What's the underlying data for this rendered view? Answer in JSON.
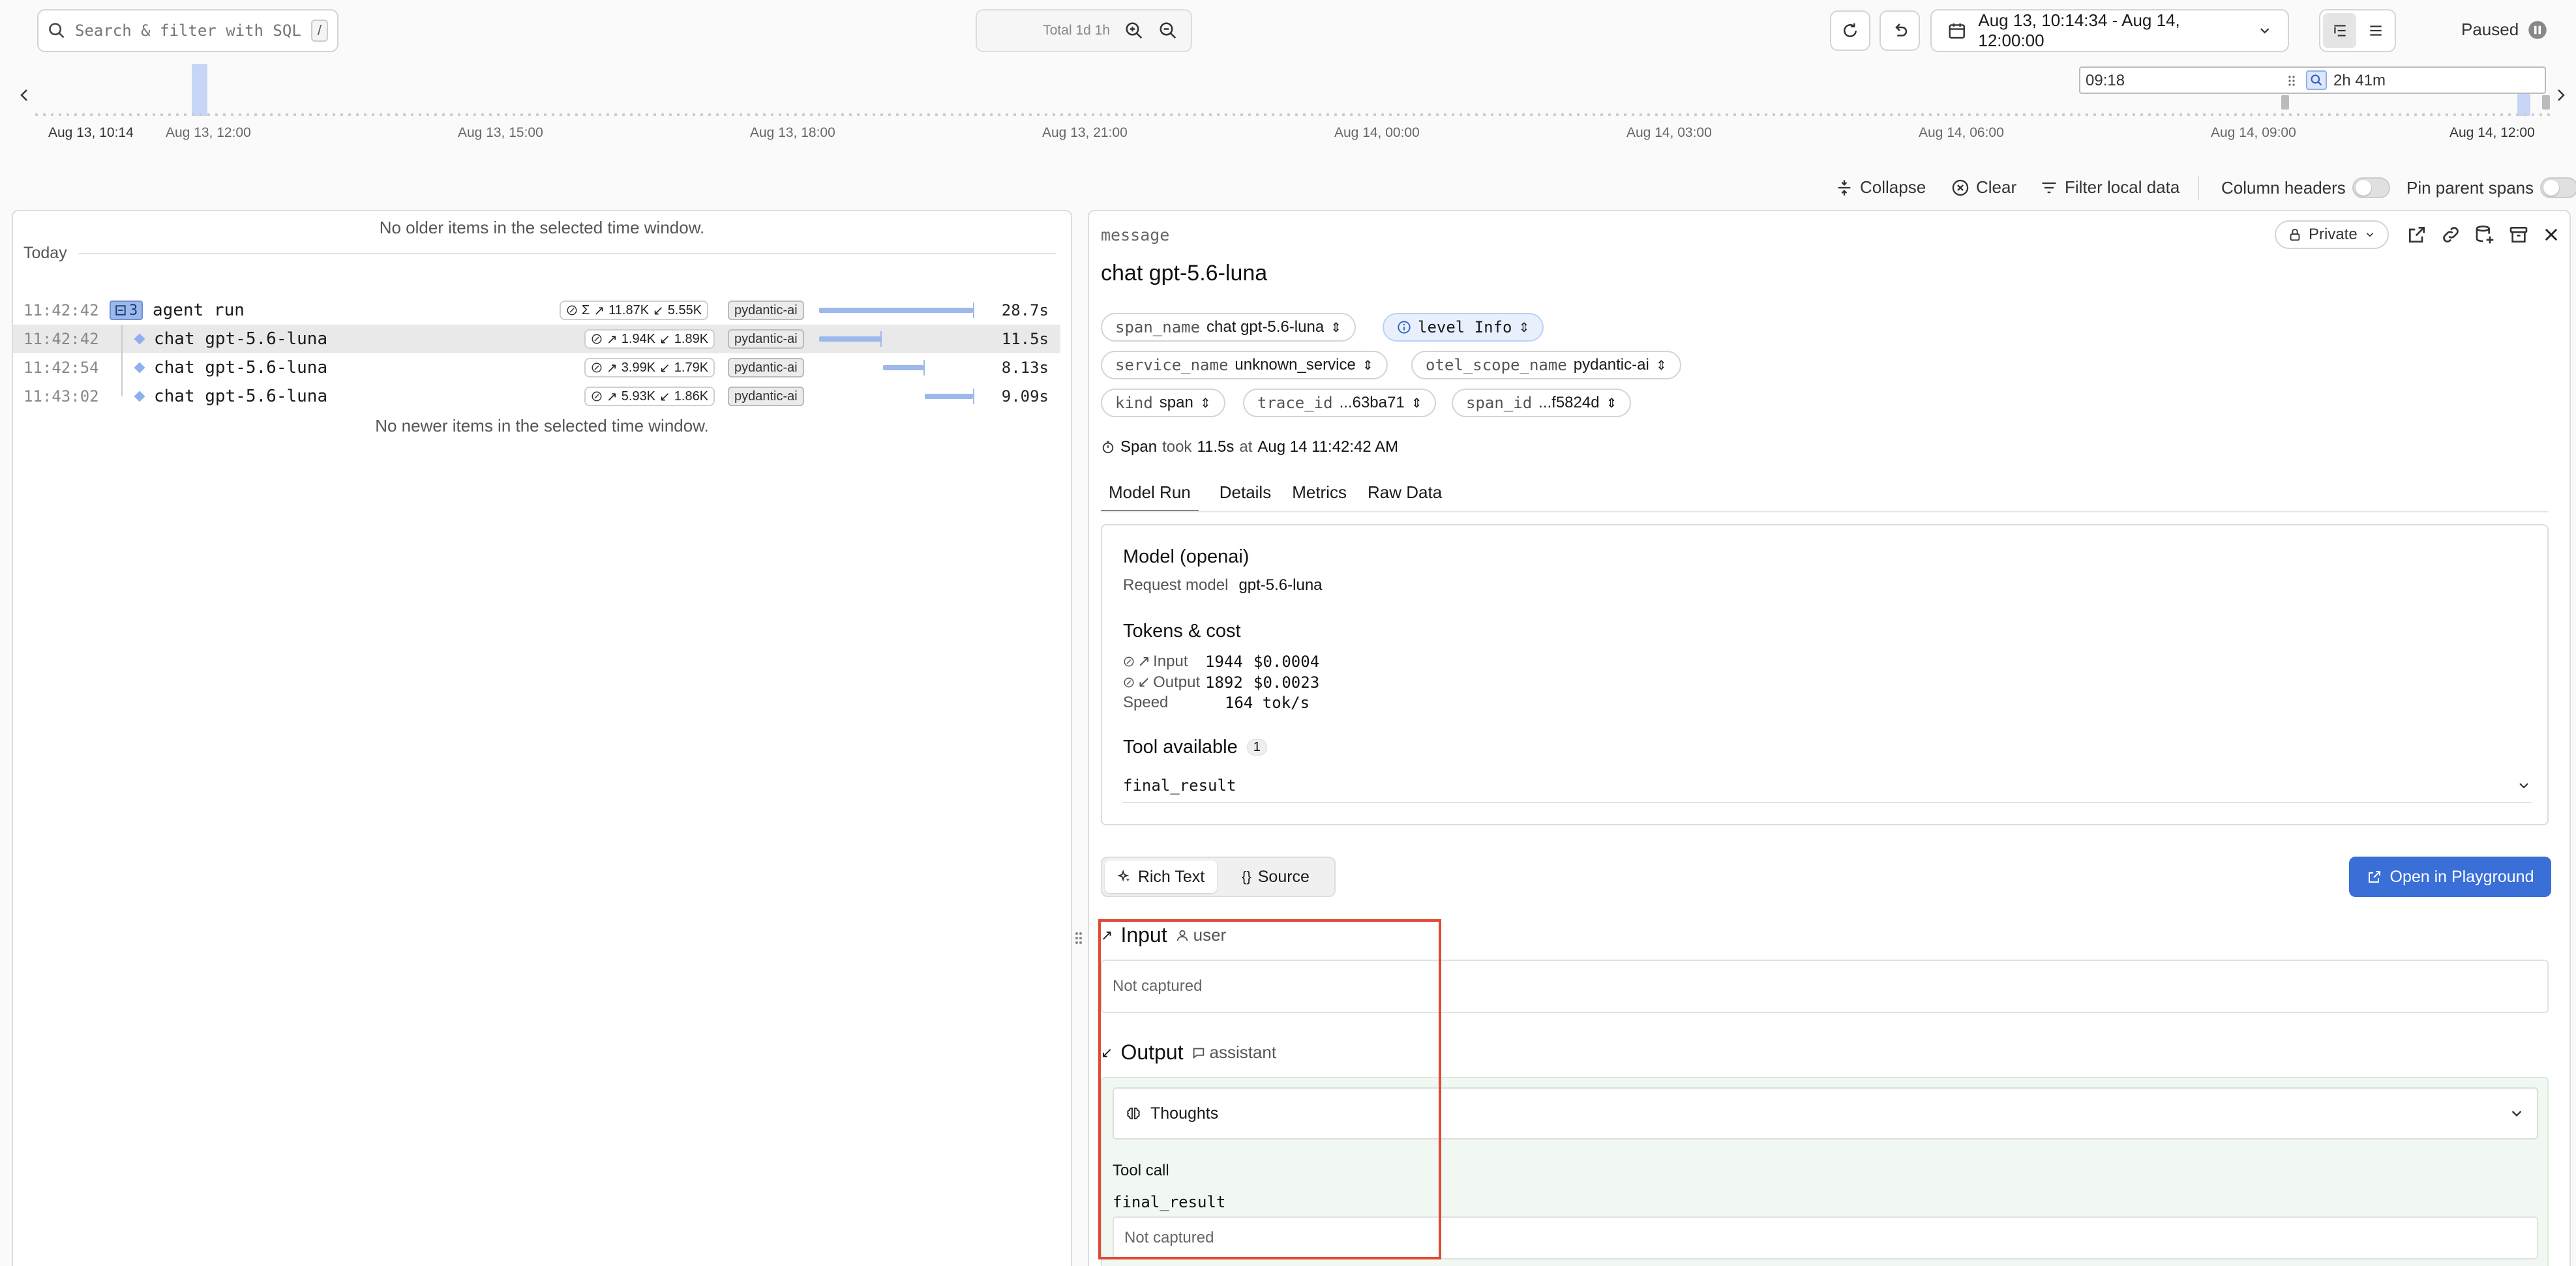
{
  "search": {
    "placeholder": "Search & filter with SQL...",
    "shortcut": "/"
  },
  "timebar": {
    "total_label": "Total 1d 1h"
  },
  "date_range": {
    "label": "Aug 13, 10:14:34 - Aug 14, 12:00:00"
  },
  "status": {
    "label": "Paused"
  },
  "timeline": {
    "start_label": "Aug 13, 10:14",
    "ticks": [
      "Aug 13, 12:00",
      "Aug 13, 15:00",
      "Aug 13, 18:00",
      "Aug 13, 21:00",
      "Aug 14, 00:00",
      "Aug 14, 03:00",
      "Aug 14, 06:00",
      "Aug 14, 09:00",
      "Aug 14, 12:00"
    ],
    "window_start": "09:18",
    "window_span": "2h 41m"
  },
  "toolbar": {
    "collapse": "Collapse",
    "clear": "Clear",
    "filter_local": "Filter local data",
    "column_headers": "Column headers",
    "pin_parent": "Pin parent spans"
  },
  "list": {
    "older_notice": "No older items in the selected time window.",
    "newer_notice": "No newer items in the selected time window.",
    "group_label": "Today",
    "rows": [
      {
        "time": "11:42:42",
        "badge": "3",
        "name": "agent run",
        "sigma": "Σ",
        "tokens_in": "11.87K",
        "tokens_out": "5.55K",
        "tag": "pydantic-ai",
        "duration": "28.7s"
      },
      {
        "time": "11:42:42",
        "name": "chat gpt-5.6-luna",
        "tokens_in": "1.94K",
        "tokens_out": "1.89K",
        "tag": "pydantic-ai",
        "duration": "11.5s"
      },
      {
        "time": "11:42:54",
        "name": "chat gpt-5.6-luna",
        "tokens_in": "3.99K",
        "tokens_out": "1.79K",
        "tag": "pydantic-ai",
        "duration": "8.13s"
      },
      {
        "time": "11:43:02",
        "name": "chat gpt-5.6-luna",
        "tokens_in": "5.93K",
        "tokens_out": "1.86K",
        "tag": "pydantic-ai",
        "duration": "9.09s"
      }
    ]
  },
  "detail": {
    "kind_label": "message",
    "title": "chat gpt-5.6-luna",
    "visibility": "Private",
    "chips": {
      "span_name_k": "span_name",
      "span_name_v": "chat gpt-5.6-luna",
      "level": "level Info",
      "service_name_k": "service_name",
      "service_name_v": "unknown_service",
      "otel_scope_k": "otel_scope_name",
      "otel_scope_v": "pydantic-ai",
      "kind_k": "kind",
      "kind_v": "span",
      "trace_id_k": "trace_id",
      "trace_id_v": "...63ba71",
      "span_id_k": "span_id",
      "span_id_v": "...f5824d"
    },
    "span_info": {
      "prefix": "Span",
      "took": "took",
      "duration": "11.5s",
      "at": "at",
      "timestamp": "Aug 14 11:42:42 AM"
    },
    "tabs": [
      "Model Run",
      "Details",
      "Metrics",
      "Raw Data"
    ],
    "model": {
      "heading": "Model (openai)",
      "request_label": "Request model",
      "request_value": "gpt-5.6-luna"
    },
    "tokens": {
      "heading": "Tokens & cost",
      "input_label": "Input",
      "input_count": "1944",
      "input_cost": "$0.0004",
      "output_label": "Output",
      "output_count": "1892",
      "output_cost": "$0.0023",
      "speed_label": "Speed",
      "speed_value": "164 tok/s"
    },
    "tools": {
      "heading": "Tool available",
      "count": "1",
      "item": "final_result"
    },
    "view_toggle": {
      "rich": "Rich Text",
      "source": "Source"
    },
    "playground": "Open in Playground",
    "input": {
      "heading": "Input",
      "role": "user",
      "value": "Not captured"
    },
    "output": {
      "heading": "Output",
      "role": "assistant",
      "thoughts": "Thoughts",
      "tool_call_label": "Tool call",
      "tool_call_name": "final_result",
      "tool_call_value": "Not captured"
    }
  },
  "colors": {
    "accent": "#3a6fd8",
    "bar": "#9db8ea",
    "highlight": "#e04b35"
  }
}
